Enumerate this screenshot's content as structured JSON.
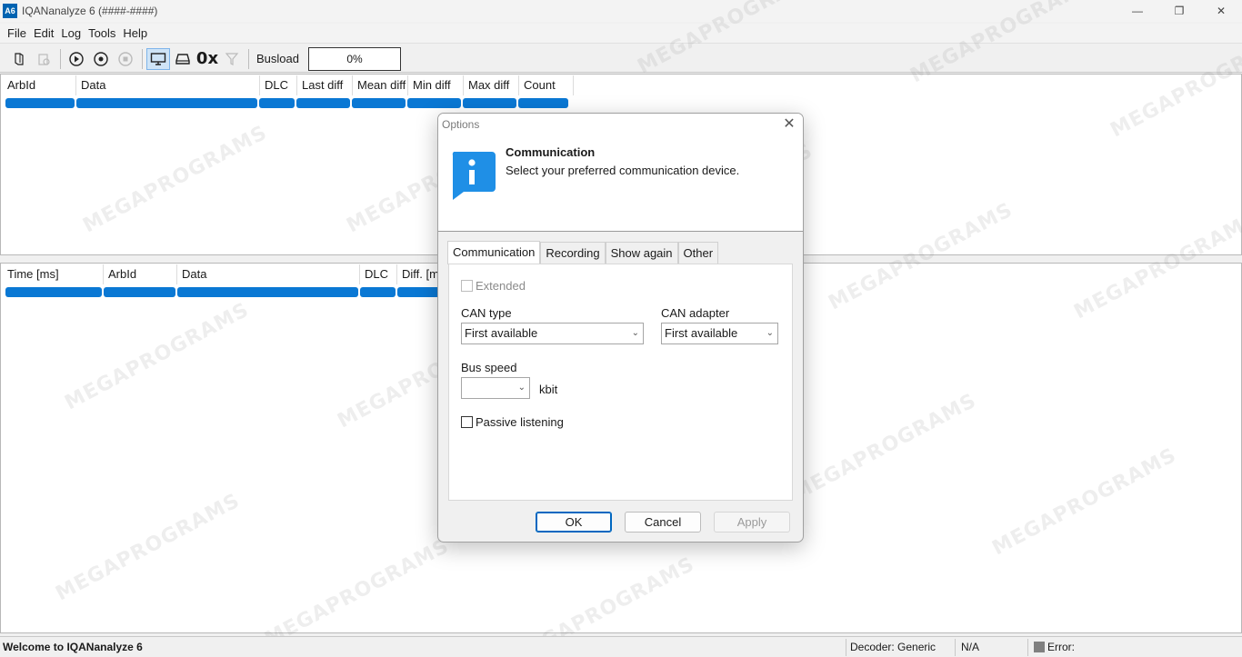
{
  "window": {
    "icon_text": "A6",
    "title": "IQANanalyze 6 (####-####)",
    "controls": [
      "—",
      "❐",
      "✕"
    ]
  },
  "menu": [
    "File",
    "Edit",
    "Log",
    "Tools",
    "Help"
  ],
  "toolbar": {
    "hex_label": "0x",
    "busload_label": "Busload",
    "busload_value": "0%"
  },
  "top_grid": {
    "columns": [
      "ArbId",
      "Data",
      "DLC",
      "Last diff",
      "Mean diff",
      "Min diff",
      "Max diff",
      "Count"
    ]
  },
  "bottom_grid": {
    "columns": [
      "Time [ms]",
      "ArbId",
      "Data",
      "DLC",
      "Diff. [ms]"
    ]
  },
  "status": {
    "welcome": "Welcome to IQANanalyze 6",
    "decoder": "Decoder: Generic",
    "na": "N/A",
    "error": "Error:"
  },
  "watermark": "MEGAPROGRAMS",
  "dialog": {
    "title": "Options",
    "close": "✕",
    "header_title": "Communication",
    "header_subtitle": "Select your preferred communication device.",
    "tabs": [
      "Communication",
      "Recording",
      "Show again",
      "Other"
    ],
    "extended_label": "Extended",
    "can_type_label": "CAN type",
    "can_type_value": "First available",
    "can_adapter_label": "CAN adapter",
    "can_adapter_value": "First available",
    "bus_speed_label": "Bus speed",
    "bus_speed_value": "",
    "bus_speed_unit": "kbit",
    "passive_label": "Passive listening",
    "ok": "OK",
    "cancel": "Cancel",
    "apply": "Apply"
  }
}
